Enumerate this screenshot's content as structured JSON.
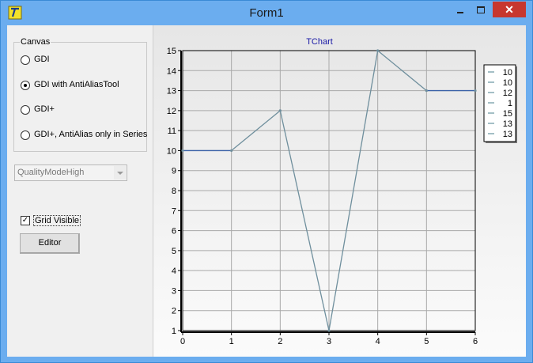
{
  "window": {
    "title": "Form1",
    "close_symbol": "✕"
  },
  "canvas_group": {
    "title": "Canvas",
    "options": [
      {
        "label": "GDI",
        "selected": false
      },
      {
        "label": "GDI with AntiAliasTool",
        "selected": true
      },
      {
        "label": "GDI+",
        "selected": false
      },
      {
        "label": "GDI+, AntiAlias only in Series",
        "selected": false
      }
    ]
  },
  "quality_combo": {
    "value": "QualityModeHigh"
  },
  "grid_checkbox": {
    "label": "Grid Visible",
    "checked": true,
    "mark": "✓"
  },
  "editor_button": {
    "label": "Editor"
  },
  "chart_data": {
    "type": "line",
    "title": "TChart",
    "x": [
      0,
      1,
      2,
      3,
      4,
      5,
      6
    ],
    "values": [
      10,
      10,
      12,
      1,
      15,
      13,
      13
    ],
    "xlim": [
      0,
      6
    ],
    "ylim": [
      1,
      15
    ],
    "x_ticks": [
      "0",
      "1",
      "2",
      "3",
      "4",
      "5",
      "6"
    ],
    "y_ticks": [
      "1",
      "2",
      "3",
      "4",
      "5",
      "6",
      "7",
      "8",
      "9",
      "10",
      "11",
      "12",
      "13",
      "14",
      "15"
    ],
    "legend": [
      "10",
      "10",
      "12",
      "1",
      "15",
      "13",
      "13"
    ],
    "legend_position": "right",
    "grid": true,
    "colors": {
      "title": "#1a1aa6",
      "line_flat": "#3b62a8",
      "line_slope": "#6f8f9d",
      "grid": "#a9a9a9",
      "legend_swatch": "#4a7f8c"
    }
  }
}
